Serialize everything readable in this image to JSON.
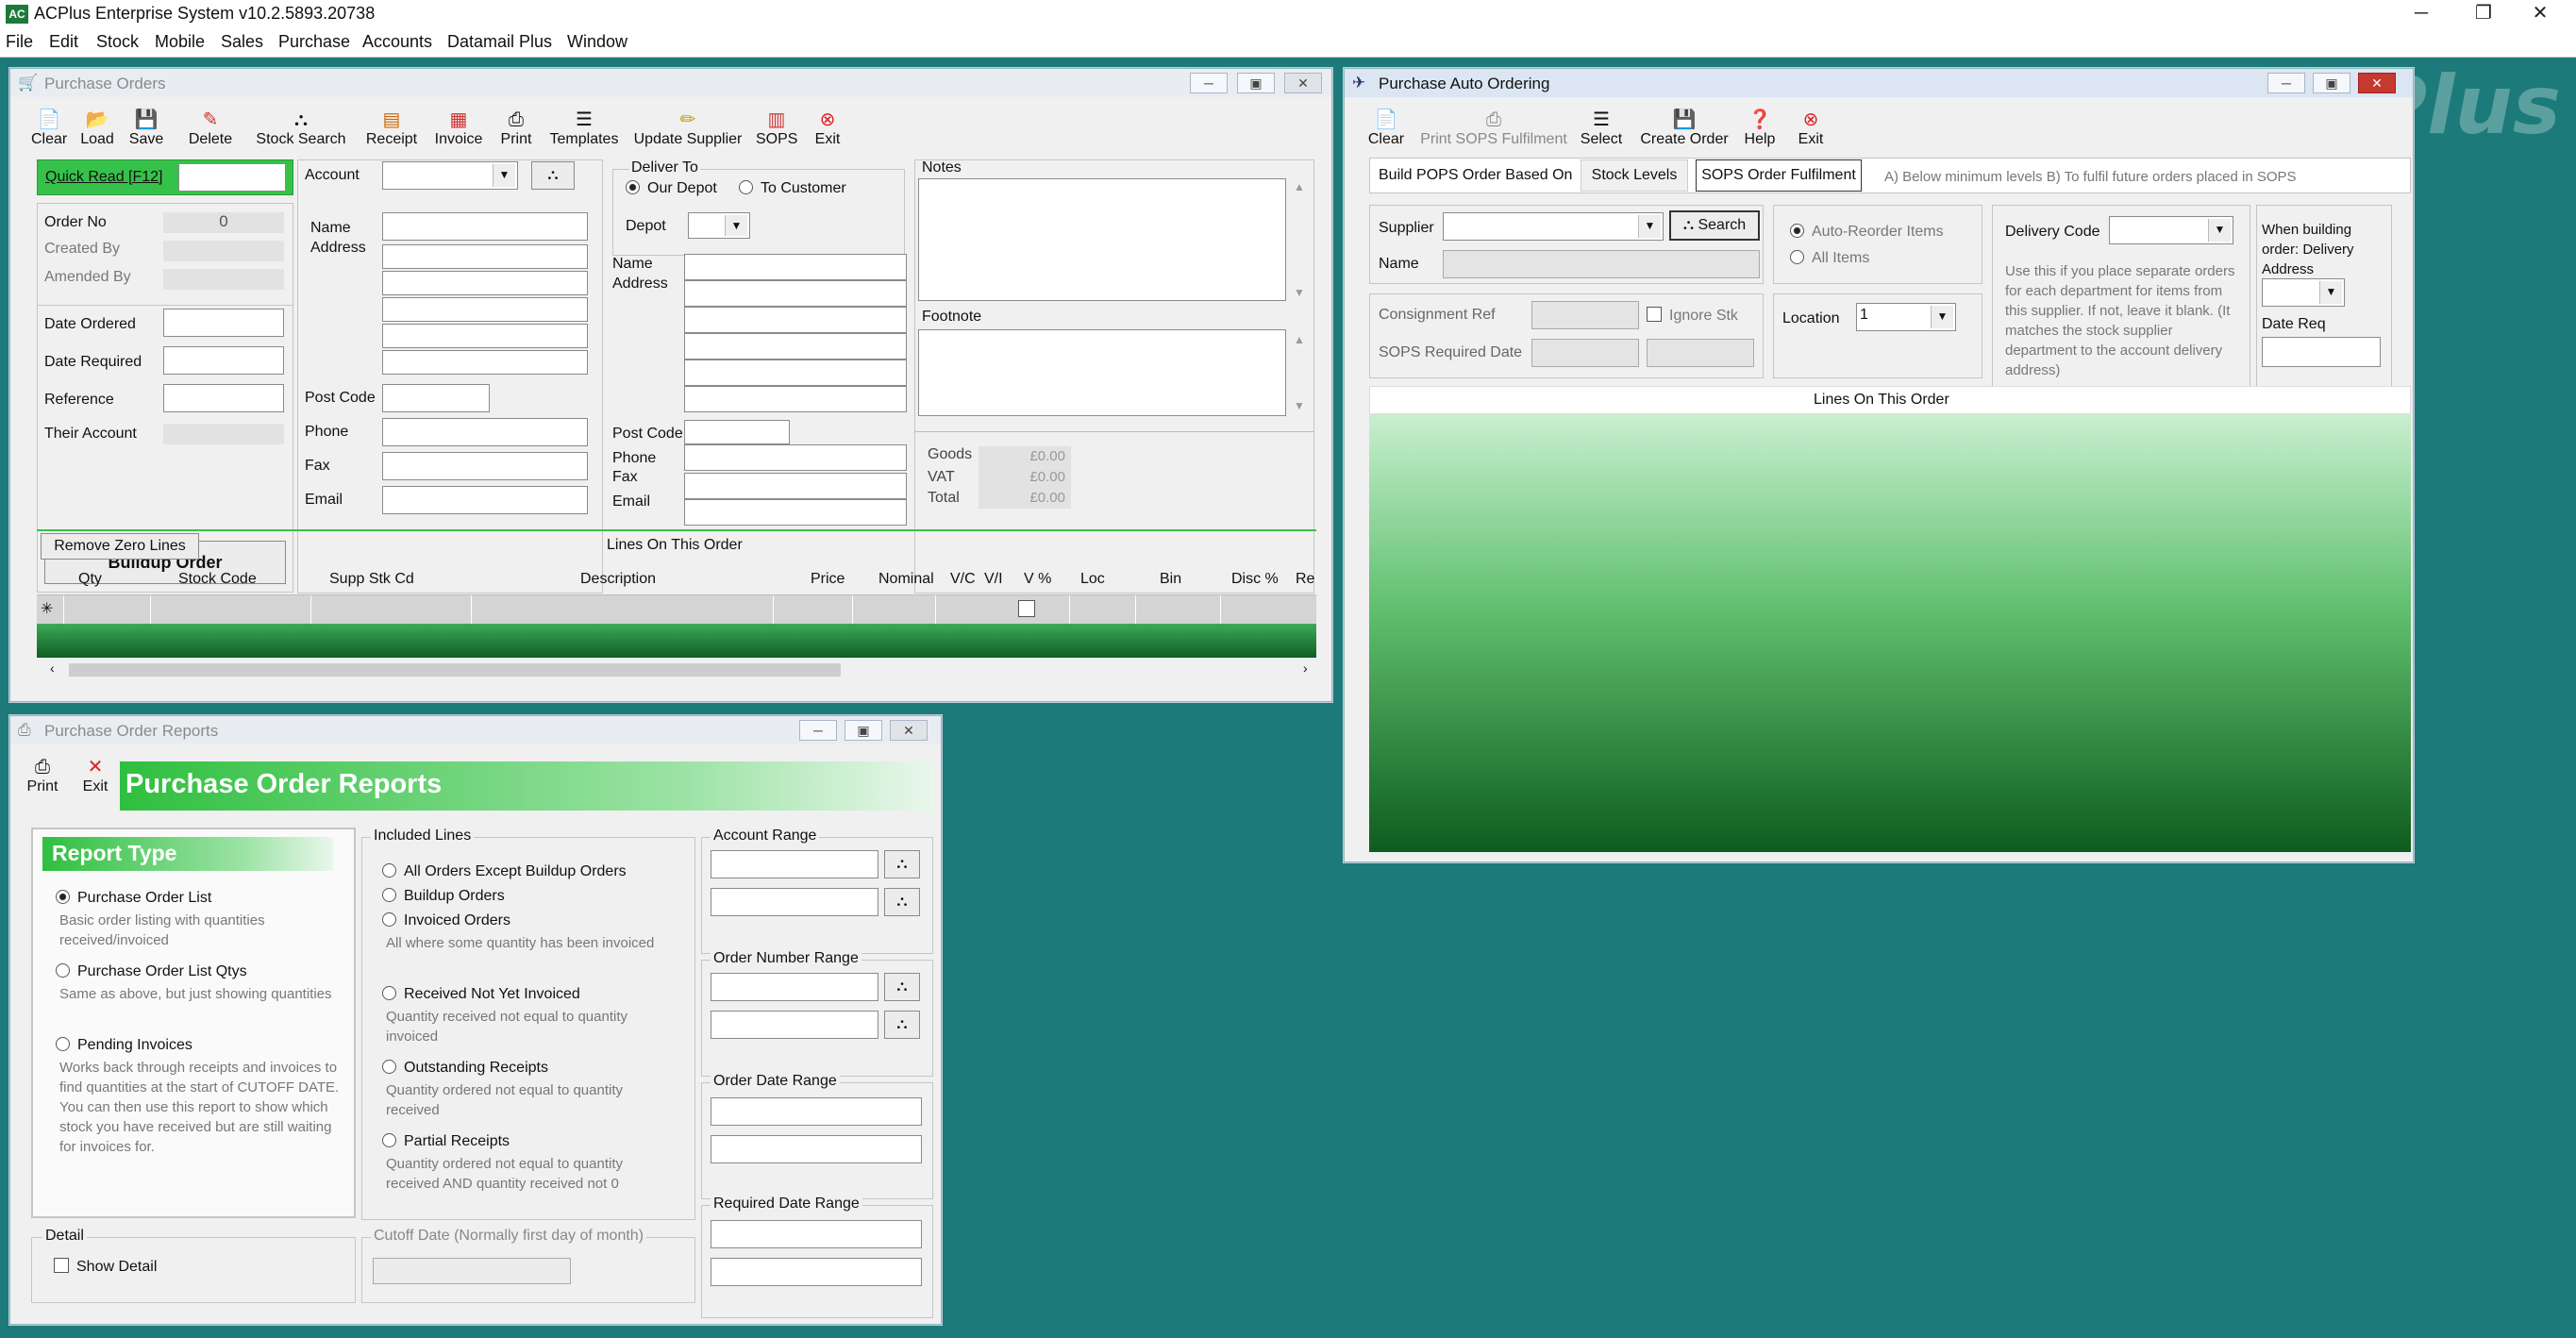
{
  "app": {
    "title": "ACPlus Enterprise System v10.2.5893.20738",
    "logo": "AC",
    "watermark": "Plus"
  },
  "menu": [
    "File",
    "Edit",
    "Stock",
    "Mobile",
    "Sales",
    "Purchase",
    "Accounts",
    "Datamail Plus",
    "Window"
  ],
  "po": {
    "title": "Purchase Orders",
    "toolbar": [
      "Clear",
      "Load",
      "Save",
      "Delete",
      "Stock Search",
      "Receipt",
      "Invoice",
      "Print",
      "Templates",
      "Update Supplier",
      "SOPS",
      "Exit"
    ],
    "quick_read": "Quick Read [F12]",
    "order_no_label": "Order No",
    "order_no": "0",
    "created_by": "Created By",
    "amended_by": "Amended By",
    "date_ordered": "Date Ordered",
    "date_required": "Date Required",
    "reference": "Reference",
    "their_account": "Their Account",
    "buildup": "Buildup Order",
    "account": "Account",
    "name_address": "Name\nAddress",
    "post_code": "Post Code",
    "phone": "Phone",
    "fax": "Fax",
    "email": "Email",
    "deliver_to": "Deliver To",
    "our_depot": "Our Depot",
    "to_customer": "To Customer",
    "depot": "Depot",
    "notes": "Notes",
    "footnote": "Footnote",
    "goods": "Goods",
    "vat": "VAT",
    "total": "Total",
    "goods_v": "£0.00",
    "vat_v": "£0.00",
    "total_v": "£0.00",
    "remove_zero": "Remove Zero Lines",
    "lines": "Lines On This Order",
    "columns": [
      "Qty",
      "Stock Code",
      "Supp Stk Cd",
      "Description",
      "Price",
      "Nominal",
      "V/C",
      "V/I",
      "V %",
      "Loc",
      "Bin",
      "Disc %",
      "Re"
    ],
    "new_row_marker": "✳"
  },
  "pao": {
    "title": "Purchase Auto Ordering",
    "toolbar": [
      "Clear",
      "Print SOPS Fulfilment",
      "Select",
      "Create Order",
      "Help",
      "Exit"
    ],
    "build_based": "Build POPS Order Based On",
    "tab1": "Stock Levels",
    "tab2": "SOPS Order Fulfilment",
    "tab_hint": "A) Below minimum levels  B) To fulfil future orders placed in SOPS",
    "supplier": "Supplier",
    "search": "Search",
    "name": "Name",
    "auto_reorder": "Auto-Reorder Items",
    "all_items": "All Items",
    "delivery_code": "Delivery Code",
    "delivery_hint": "Use this if you place separate orders for each department for items from this supplier.  If not, leave it blank. (It matches the stock supplier department to the account delivery address)",
    "when_building": "When building order: Delivery Address",
    "date_req": "Date Req",
    "consignment": "Consignment Ref",
    "ignore_stk": "Ignore Stk",
    "sops_date": "SOPS Required Date",
    "location": "Location",
    "location_v": "1",
    "lines": "Lines On This Order"
  },
  "por": {
    "title": "Purchase Order Reports",
    "toolbar": [
      "Print",
      "Exit"
    ],
    "header": "Purchase Order Reports",
    "report_type": "Report Type",
    "types": [
      {
        "label": "Purchase Order List",
        "desc": "Basic order listing with quantities received/invoiced"
      },
      {
        "label": "Purchase Order List Qtys",
        "desc": "Same as above, but just showing quantities"
      },
      {
        "label": "Pending Invoices",
        "desc": "Works back through receipts and invoices to find quantities at the start of CUTOFF DATE.  You can then use this report to show which stock you have received but are still waiting for invoices for."
      }
    ],
    "included": "Included Lines",
    "inc": [
      {
        "label": "All Orders Except Buildup Orders",
        "desc": ""
      },
      {
        "label": "Buildup Orders",
        "desc": ""
      },
      {
        "label": "Invoiced Orders",
        "desc": "All where some quantity has been invoiced"
      },
      {
        "label": "Received Not Yet Invoiced",
        "desc": "Quantity received not equal to quantity invoiced"
      },
      {
        "label": "Outstanding Receipts",
        "desc": "Quantity ordered not equal to quantity received"
      },
      {
        "label": "Partial Receipts",
        "desc": "Quantity ordered not equal to quantity received AND quantity received not 0"
      }
    ],
    "account_range": "Account Range",
    "order_number_range": "Order Number Range",
    "order_date_range": "Order Date Range",
    "required_date_range": "Required Date Range",
    "detail": "Detail",
    "show_detail": "Show Detail",
    "cutoff": "Cutoff Date (Normally first day of month)"
  }
}
